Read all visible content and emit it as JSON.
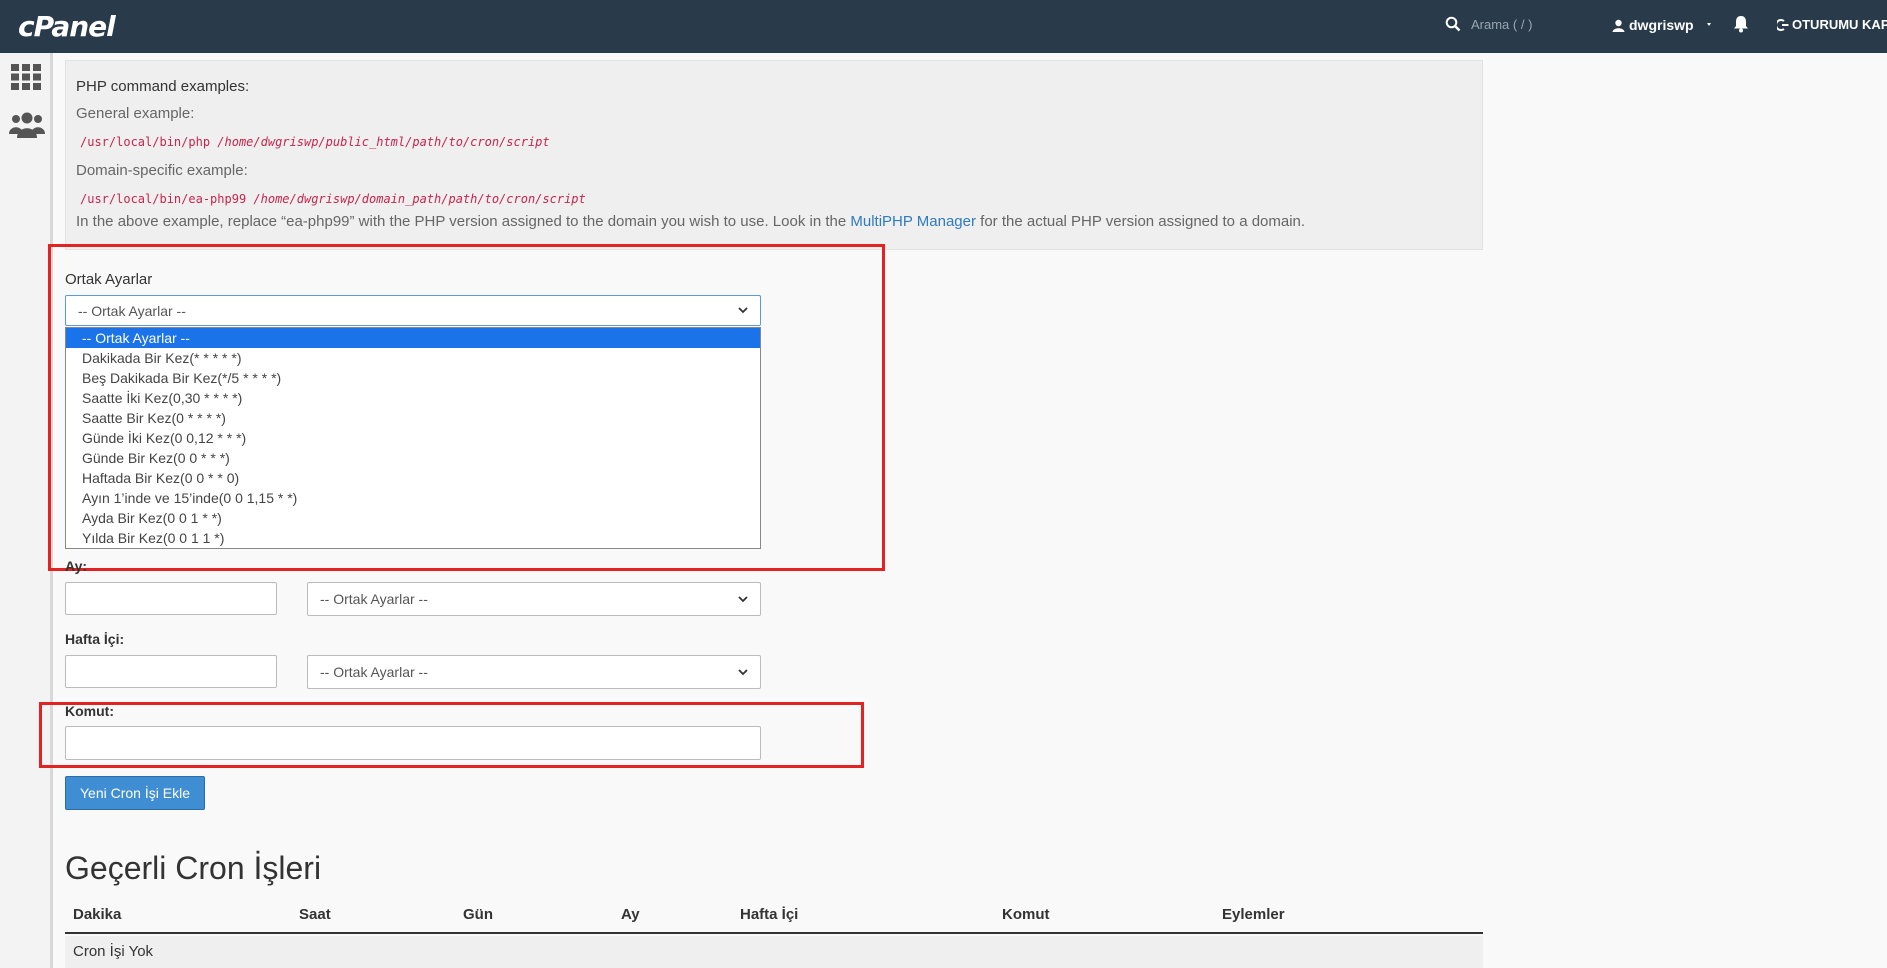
{
  "topbar": {
    "logo": "cPanel",
    "search_placeholder": "Arama ( / )",
    "user": "dwgriswp",
    "logout": "OTURUMU KAPAT"
  },
  "info": {
    "title": "PHP command examples:",
    "general_label": "General example:",
    "general_cmd_plain": "/usr/local/bin/php",
    "general_cmd_path": "/home/dwgriswp/public_html/path/to/cron/script",
    "domain_label": "Domain-specific example:",
    "domain_cmd_plain": "/usr/local/bin/ea-php99",
    "domain_cmd_path": "/home/dwgriswp/domain_path/path/to/cron/script",
    "note_before": "In the above example, replace “ea-php99” with the PHP version assigned to the domain you wish to use. Look in the",
    "note_link": "MultiPHP Manager",
    "note_after": "for the actual PHP version assigned to a domain."
  },
  "form": {
    "common_label": "Ortak Ayarlar",
    "common_selected": "-- Ortak Ayarlar --",
    "dropdown_options": [
      "-- Ortak Ayarlar --",
      "Dakikada Bir Kez(* * * * *)",
      "Beş Dakikada Bir Kez(*/5 * * * *)",
      "Saatte İki Kez(0,30 * * * *)",
      "Saatte Bir Kez(0 * * * *)",
      "Günde İki Kez(0 0,12 * * *)",
      "Günde Bir Kez(0 0 * * *)",
      "Haftada Bir Kez(0 0 * * 0)",
      "Ayın 1’inde ve 15’inde(0 0 1,15 * *)",
      "Ayda Bir Kez(0 0 1 * *)",
      "Yılda Bir Kez(0 0 1 1 *)"
    ],
    "month_label": "Ay:",
    "month_select": "-- Ortak Ayarlar --",
    "weekday_label": "Hafta İçi:",
    "weekday_select": "-- Ortak Ayarlar --",
    "command_label": "Komut:",
    "submit": "Yeni Cron İşi Ekle"
  },
  "jobs": {
    "title": "Geçerli Cron İşleri",
    "columns": [
      "Dakika",
      "Saat",
      "Gün",
      "Ay",
      "Hafta İçi",
      "Komut",
      "Eylemler"
    ],
    "empty": "Cron İşi Yok"
  },
  "colors": {
    "topbar": "#293a4a",
    "highlight": "#e32222",
    "primary": "#3f8ed4"
  }
}
